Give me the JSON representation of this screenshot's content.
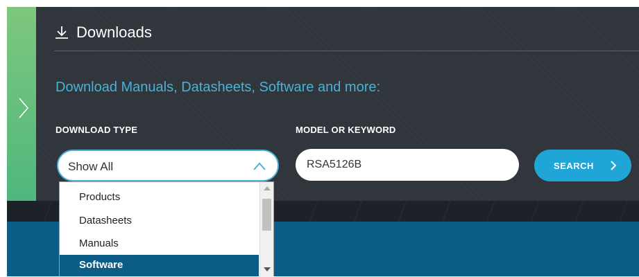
{
  "downloads": {
    "title": "Downloads",
    "icon": "download-icon",
    "subtitle": "Download Manuals, Datasheets, Software and more:"
  },
  "form": {
    "type_label": "DOWNLOAD TYPE",
    "model_label": "MODEL OR KEYWORD",
    "type_selected": "Show All",
    "model_value": "RSA5126B",
    "search_label": "SEARCH"
  },
  "dropdown": {
    "options": [
      "Products",
      "Datasheets",
      "Manuals",
      "Software"
    ],
    "highlighted": "Software"
  },
  "colors": {
    "panel": "#2f353b",
    "accent": "#49b2d6",
    "button": "#20a6d6",
    "highlight": "#0c5d86",
    "side_tab": "#4fb77d"
  }
}
